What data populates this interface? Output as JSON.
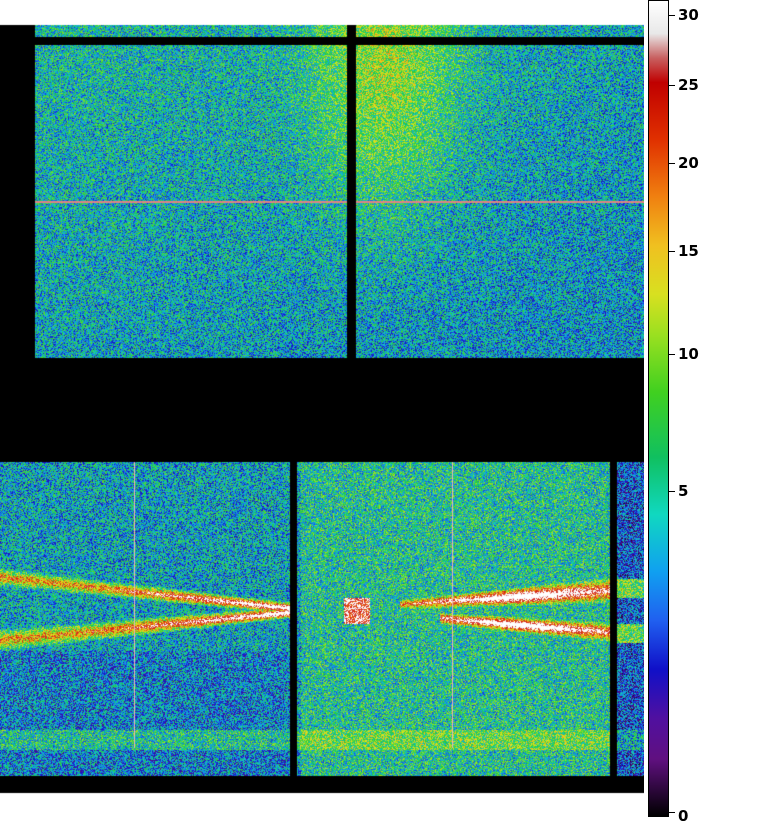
{
  "colorbar": {
    "ticks": [
      {
        "label": "30",
        "value": 30
      },
      {
        "label": "25",
        "value": 25
      },
      {
        "label": "20",
        "value": 20
      },
      {
        "label": "15",
        "value": 15
      },
      {
        "label": "10",
        "value": 10
      },
      {
        "label": "5",
        "value": 5
      },
      {
        "label": "0",
        "value": 0
      }
    ],
    "colors": [
      "#000000",
      "#6a0a8a",
      "#1010c0",
      "#1d7cf0",
      "#19d6b4",
      "#1fcf3a",
      "#a6e22a",
      "#f0e020",
      "#f09010",
      "#d81010",
      "#c02020",
      "#ffffff"
    ]
  }
}
